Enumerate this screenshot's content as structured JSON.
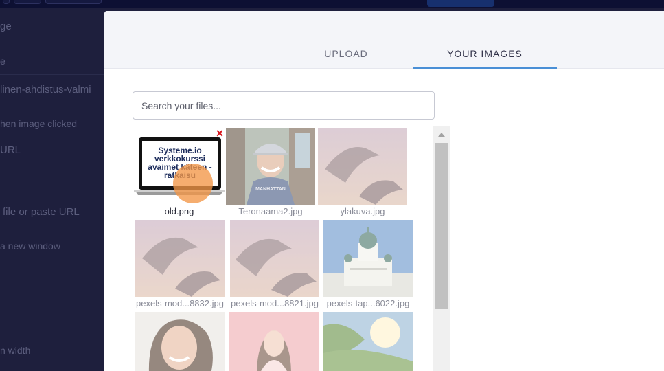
{
  "background": {
    "labels": [
      "ge",
      "e",
      "linen-ahdistus-valmi",
      "hen image clicked",
      "URL",
      "file or paste URL",
      "a new window",
      "n width"
    ]
  },
  "tabs": [
    {
      "label": "UPLOAD",
      "active": false
    },
    {
      "label": "YOUR IMAGES",
      "active": true
    }
  ],
  "search": {
    "placeholder": "Search your files...",
    "value": ""
  },
  "images": [
    {
      "name": "old.png",
      "selected": true,
      "thumb_text": "Systeme.io verkkokurssi avaimet käteen -ratkaisu"
    },
    {
      "name": "Teronaama2.jpg",
      "selected": false,
      "shirt_text": "MANHATTAN"
    },
    {
      "name": "ylakuva.jpg",
      "selected": false
    },
    {
      "name": "pexels-mod...8832.jpg",
      "selected": false
    },
    {
      "name": "pexels-mod...8821.jpg",
      "selected": false
    },
    {
      "name": "pexels-tap...6022.jpg",
      "selected": false
    },
    {
      "name": "",
      "selected": false
    },
    {
      "name": "",
      "selected": false
    },
    {
      "name": "",
      "selected": false
    }
  ],
  "colors": {
    "accent": "#4a8fd6",
    "remove": "#d8141b",
    "overlay": "#1e1f3d"
  },
  "icons": {
    "remove": "×",
    "scroll_up": "triangle-up"
  }
}
